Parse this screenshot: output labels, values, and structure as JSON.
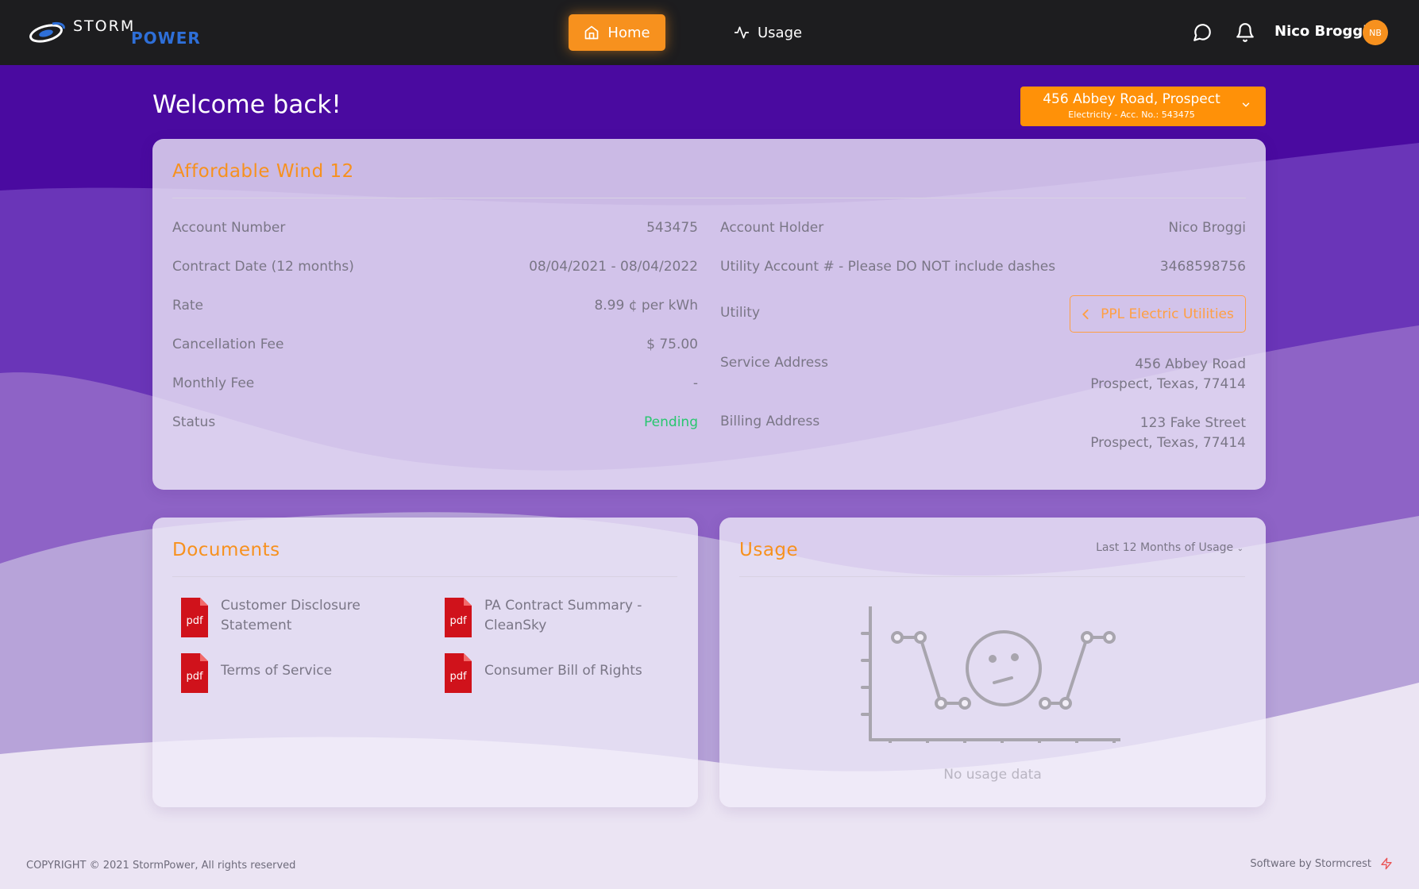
{
  "brand": {
    "name_top": "STORM",
    "name_bottom": "POWER"
  },
  "nav": {
    "home_label": "Home",
    "usage_label": "Usage",
    "user_name": "Nico Broggi",
    "user_initials": "NB"
  },
  "header": {
    "welcome": "Welcome back!",
    "address_main": "456 Abbey Road, Prospect",
    "address_sub": "Electricity - Acc. No.: 543475"
  },
  "plan": {
    "title": "Affordable Wind 12",
    "left_rows": [
      {
        "label": "Account Number",
        "value": "543475"
      },
      {
        "label": "Contract Date (12 months)",
        "value": "08/04/2021 - 08/04/2022"
      },
      {
        "label": "Rate",
        "value": "8.99 ¢ per kWh"
      },
      {
        "label": "Cancellation Fee",
        "value": "$ 75.00"
      },
      {
        "label": "Monthly Fee",
        "value": "-"
      },
      {
        "label": "Status",
        "value": "Pending"
      }
    ],
    "right_rows": [
      {
        "label": "Account Holder",
        "value": "Nico Broggi"
      },
      {
        "label": "Utility Account # - Please DO NOT include dashes",
        "value": "3468598756"
      },
      {
        "label": "Utility",
        "value": "PPL Electric Utilities"
      },
      {
        "label": "Service Address",
        "value_line1": "456 Abbey Road",
        "value_line2": "Prospect, Texas, 77414"
      },
      {
        "label": "Billing Address",
        "value_line1": "123 Fake Street",
        "value_line2": "Prospect, Texas, 77414"
      }
    ]
  },
  "documents": {
    "title": "Documents",
    "pdf_label": "pdf",
    "items": [
      {
        "label": "Customer Disclosure Statement"
      },
      {
        "label": "PA Contract Summary - CleanSky"
      },
      {
        "label": "Terms of Service"
      },
      {
        "label": "Consumer Bill of Rights"
      }
    ]
  },
  "usage": {
    "title": "Usage",
    "range_label": "Last 12 Months of Usage",
    "empty_text": "No usage data"
  },
  "footer": {
    "copyright": "COPYRIGHT © 2021 StormPower, All rights reserved",
    "credit": "Software by Stormcrest"
  },
  "colors": {
    "accent": "#f7911e",
    "topbar": "#1d1d1f",
    "purple_dark": "#4a0aa0",
    "status_pending": "#28c76f",
    "pdf_red": "#d0121b"
  }
}
